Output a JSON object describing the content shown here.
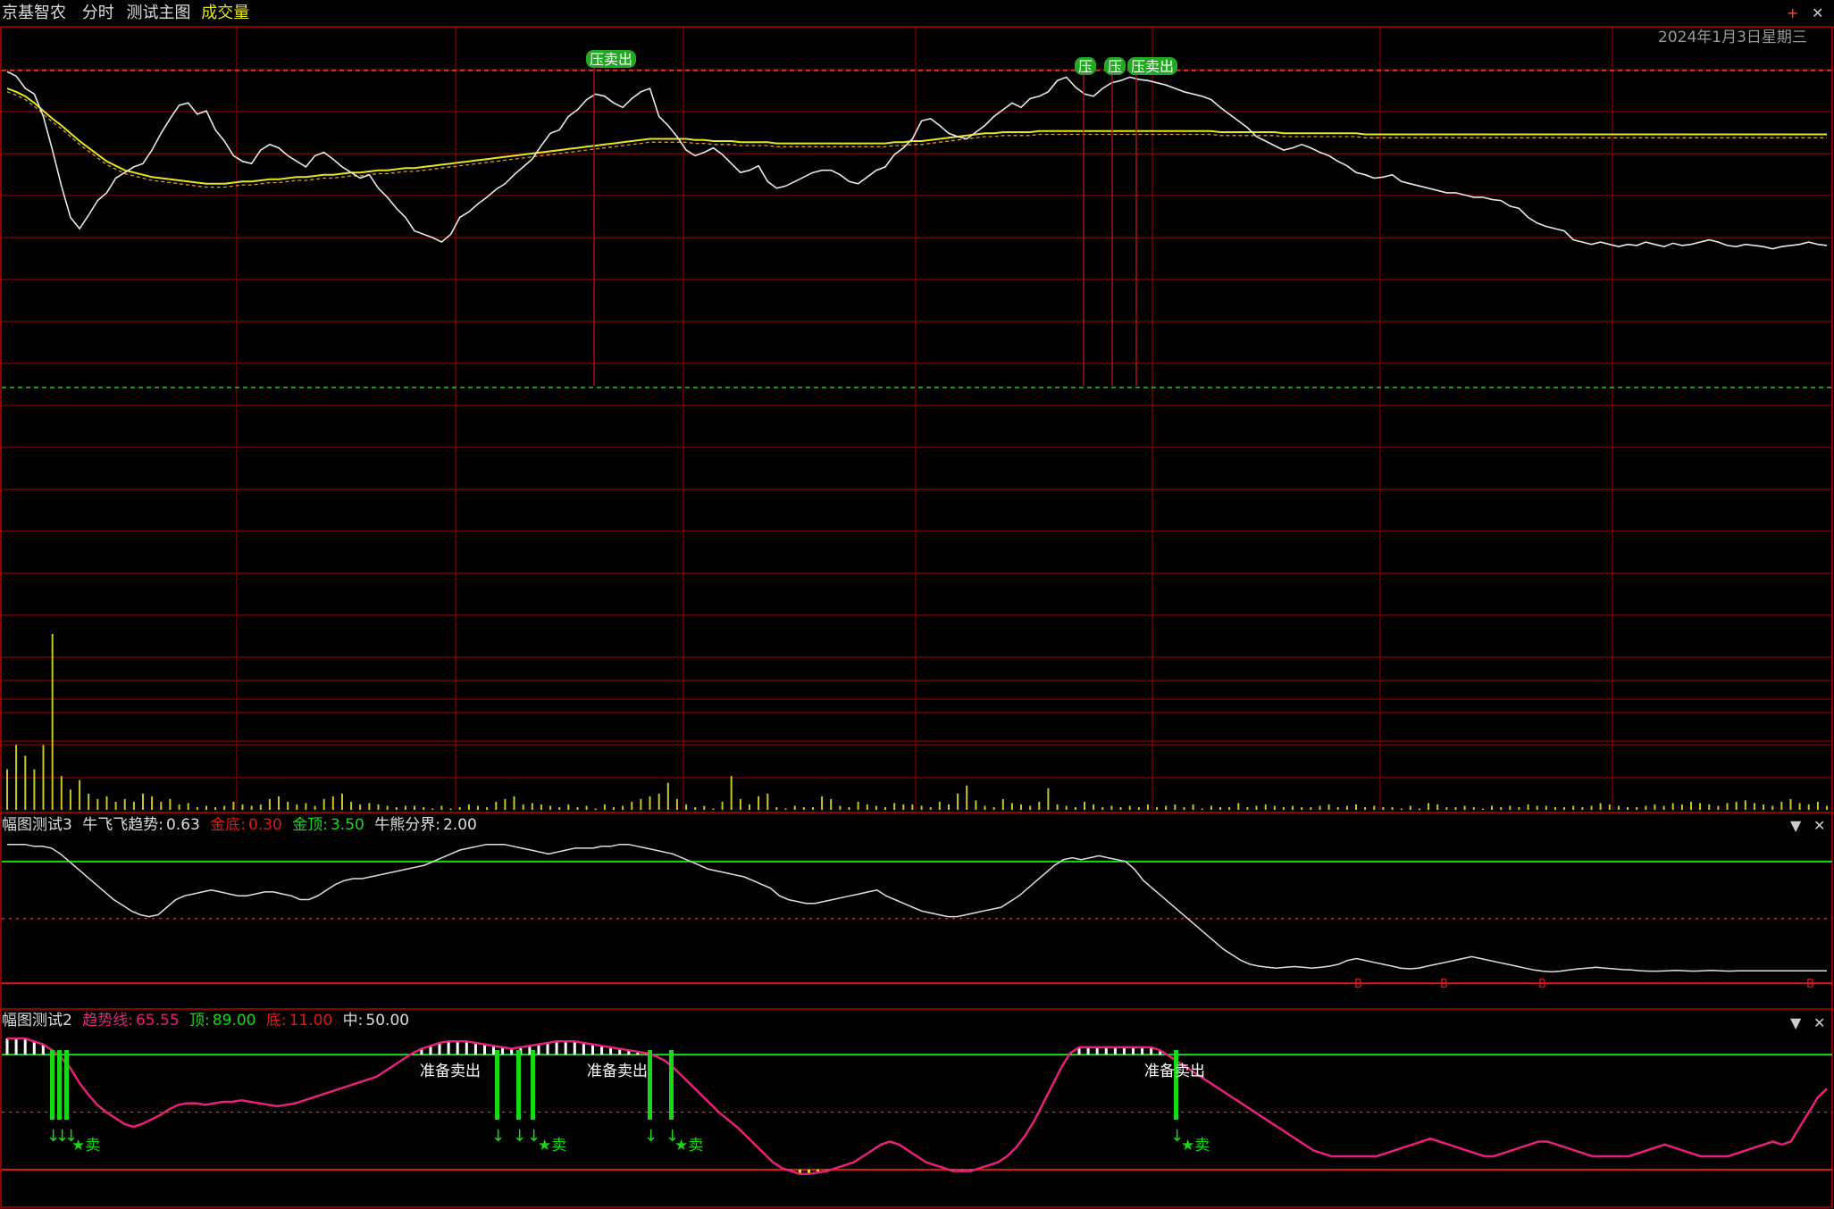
{
  "header": {
    "stock_name": "京基智农",
    "mode": "分时",
    "indicator": "测试主图",
    "volume_label": "成交量",
    "date": "2024年1月3日星期三"
  },
  "panel3": {
    "name": "幅图测试3",
    "trend_label": "牛飞飞趋势:",
    "trend_value": "0.63",
    "gold_bottom_label": "金底:",
    "gold_bottom_value": "0.30",
    "gold_top_label": "金顶:",
    "gold_top_value": "3.50",
    "divide_label": "牛熊分界:",
    "divide_value": "2.00"
  },
  "panel2": {
    "name": "幅图测试2",
    "trend_label": "趋势线:",
    "trend_value": "65.55",
    "top_label": "顶:",
    "top_value": "89.00",
    "bottom_label": "底:",
    "bottom_value": "11.00",
    "mid_label": "中:",
    "mid_value": "50.00"
  },
  "signals": {
    "pressure_sell": "压卖出",
    "pressure": "压",
    "ready_sell": "准备卖出",
    "sell": "卖",
    "star_sell": "★卖",
    "down_arrow": "↓",
    "b_mark": "B"
  },
  "icons": {
    "panel_menu": "▼",
    "panel_close": "✕",
    "window_zoom": "+",
    "window_close": "✕"
  },
  "colors": {
    "background": "#000000",
    "grid": "#8b0000",
    "price_line": "#e8e8e8",
    "avg_line": "#e6e620",
    "volume": "#c8c81e",
    "green": "#18d818",
    "red": "#e01818",
    "magenta": "#e8207a",
    "label_green_bg": "#22a822"
  },
  "chart_data": [
    {
      "type": "line",
      "title": "测试主图",
      "series": [
        {
          "values": [
            280,
            276,
            265,
            260,
            240,
            210,
            178,
            150,
            140,
            152,
            165,
            172,
            185,
            190,
            195,
            198,
            210,
            225,
            238,
            250,
            252,
            242,
            245,
            228,
            218,
            205,
            200,
            198,
            210,
            215,
            212,
            205,
            200,
            195,
            205,
            208,
            202,
            195,
            190,
            185,
            188,
            176,
            168,
            158,
            150,
            138,
            135,
            132,
            128,
            135,
            150,
            155,
            162,
            168,
            175,
            180,
            188,
            195,
            202,
            214,
            225,
            228,
            240,
            246,
            255,
            260,
            258,
            252,
            248,
            256,
            262,
            265,
            240,
            232,
            222,
            210,
            205,
            208,
            212,
            206,
            198,
            190,
            192,
            196,
            182,
            176,
            178,
            182,
            186,
            190,
            192,
            192,
            188,
            182,
            180,
            186,
            192,
            195,
            206,
            212,
            220,
            236,
            238,
            232,
            225,
            222,
            220,
            226,
            232,
            240,
            246,
            252,
            248,
            256,
            258,
            262,
            272,
            275,
            266,
            260,
            258,
            265,
            270,
            272,
            275,
            273,
            272,
            270,
            268,
            265,
            262,
            260,
            258,
            255,
            248,
            242,
            236,
            230,
            222,
            218,
            214,
            210,
            212,
            215,
            212,
            208,
            205,
            200,
            196,
            190,
            188,
            185,
            186,
            188,
            182,
            180,
            178,
            176,
            174,
            172,
            172,
            170,
            168,
            168,
            166,
            165,
            160,
            158,
            150,
            145,
            142,
            140,
            138,
            130,
            128,
            126,
            128,
            126,
            124,
            126,
            125,
            128,
            126,
            124,
            127,
            125,
            126,
            128,
            130,
            128,
            125,
            124,
            126,
            125,
            124,
            122,
            124,
            125,
            126,
            128,
            126,
            125
          ]
        },
        {
          "values": [
            265,
            262,
            258,
            252,
            245,
            238,
            232,
            225,
            218,
            212,
            206,
            200,
            196,
            192,
            190,
            188,
            186,
            185,
            184,
            183,
            182,
            181,
            180,
            180,
            180,
            181,
            182,
            182,
            183,
            184,
            184,
            185,
            186,
            186,
            187,
            188,
            188,
            189,
            190,
            190,
            191,
            192,
            192,
            193,
            194,
            194,
            195,
            196,
            197,
            198,
            199,
            200,
            201,
            202,
            203,
            204,
            205,
            206,
            207,
            208,
            209,
            210,
            211,
            212,
            213,
            214,
            215,
            216,
            217,
            218,
            219,
            220,
            220,
            220,
            220,
            220,
            219,
            219,
            218,
            218,
            218,
            217,
            217,
            217,
            217,
            216,
            216,
            216,
            216,
            216,
            216,
            216,
            216,
            216,
            216,
            216,
            216,
            216,
            217,
            217,
            218,
            218,
            219,
            220,
            221,
            222,
            223,
            224,
            225,
            225,
            226,
            226,
            226,
            226,
            227,
            227,
            227,
            227,
            227,
            227,
            227,
            227,
            227,
            227,
            227,
            227,
            227,
            227,
            227,
            227,
            227,
            227,
            227,
            227,
            226,
            226,
            226,
            226,
            226,
            226,
            226,
            225,
            225,
            225,
            225,
            225,
            225,
            225,
            225,
            225,
            224,
            224,
            224,
            224,
            224,
            224,
            224,
            224,
            224,
            224,
            224,
            224,
            224,
            224,
            224,
            224,
            224,
            224,
            224,
            224,
            224,
            224,
            224,
            224,
            224,
            224,
            224,
            224,
            224,
            224,
            224,
            224,
            224,
            224,
            224,
            224,
            224,
            224,
            224,
            224,
            224,
            224,
            224,
            224,
            224,
            224,
            224,
            224,
            224,
            224,
            224,
            224
          ]
        }
      ]
    },
    {
      "type": "bar",
      "title": "成交量",
      "values": [
        30,
        48,
        40,
        30,
        48,
        130,
        25,
        15,
        22,
        12,
        8,
        10,
        6,
        8,
        6,
        12,
        10,
        6,
        8,
        4,
        5,
        2,
        3,
        2,
        3,
        6,
        4,
        3,
        4,
        8,
        10,
        6,
        4,
        5,
        3,
        8,
        10,
        12,
        6,
        4,
        5,
        4,
        3,
        2,
        3,
        3,
        2,
        1,
        3,
        1,
        2,
        4,
        3,
        2,
        6,
        8,
        10,
        4,
        5,
        4,
        3,
        2,
        4,
        2,
        3,
        1,
        4,
        2,
        3,
        6,
        8,
        10,
        12,
        20,
        8,
        4,
        2,
        3,
        1,
        6,
        25,
        8,
        4,
        10,
        12,
        2,
        1,
        3,
        2,
        2,
        10,
        8,
        3,
        2,
        6,
        4,
        3,
        2,
        5,
        4,
        4,
        3,
        2,
        6,
        4,
        12,
        18,
        7,
        3,
        2,
        8,
        5,
        4,
        3,
        6,
        16,
        4,
        3,
        2,
        6,
        4,
        2,
        3,
        2,
        3,
        2,
        4,
        2,
        3,
        4,
        2,
        4,
        1,
        3,
        2,
        2,
        5,
        2,
        3,
        4,
        3,
        2,
        3,
        2,
        2,
        3,
        4,
        2,
        3,
        4,
        2,
        3,
        2,
        2,
        1,
        3,
        1,
        5,
        4,
        2,
        2,
        3,
        2,
        1,
        3,
        2,
        3,
        2,
        4,
        3,
        3,
        2,
        2,
        3,
        2,
        3,
        5,
        4,
        3,
        2,
        2,
        3,
        4,
        3,
        5,
        4,
        6,
        5,
        4,
        3,
        5,
        6,
        7,
        5,
        4,
        3,
        6,
        8,
        5,
        4,
        6,
        3
      ]
    },
    {
      "type": "line",
      "title": "幅图测试3",
      "series": [
        {
          "name": "牛飞飞趋势",
          "values": [
            3.95,
            3.95,
            3.95,
            3.9,
            3.9,
            3.85,
            3.7,
            3.5,
            3.3,
            3.1,
            2.9,
            2.7,
            2.5,
            2.35,
            2.2,
            2.1,
            2.05,
            2.1,
            2.3,
            2.5,
            2.6,
            2.65,
            2.7,
            2.75,
            2.7,
            2.65,
            2.6,
            2.6,
            2.65,
            2.7,
            2.7,
            2.65,
            2.6,
            2.5,
            2.5,
            2.6,
            2.75,
            2.9,
            3.0,
            3.05,
            3.05,
            3.1,
            3.15,
            3.2,
            3.25,
            3.3,
            3.35,
            3.4,
            3.5,
            3.6,
            3.7,
            3.8,
            3.85,
            3.9,
            3.95,
            3.95,
            3.95,
            3.9,
            3.85,
            3.8,
            3.75,
            3.7,
            3.75,
            3.8,
            3.85,
            3.85,
            3.85,
            3.9,
            3.9,
            3.95,
            3.95,
            3.9,
            3.85,
            3.8,
            3.75,
            3.7,
            3.6,
            3.5,
            3.4,
            3.3,
            3.25,
            3.2,
            3.15,
            3.1,
            3.0,
            2.9,
            2.8,
            2.6,
            2.5,
            2.45,
            2.4,
            2.4,
            2.45,
            2.5,
            2.55,
            2.6,
            2.65,
            2.7,
            2.75,
            2.6,
            2.5,
            2.4,
            2.3,
            2.2,
            2.15,
            2.1,
            2.05,
            2.05,
            2.1,
            2.15,
            2.2,
            2.25,
            2.3,
            2.45,
            2.6,
            2.8,
            3.0,
            3.2,
            3.4,
            3.55,
            3.6,
            3.55,
            3.6,
            3.65,
            3.6,
            3.55,
            3.5,
            3.3,
            3.0,
            2.8,
            2.6,
            2.4,
            2.2,
            2.0,
            1.8,
            1.6,
            1.4,
            1.2,
            1.05,
            0.9,
            0.8,
            0.75,
            0.72,
            0.7,
            0.72,
            0.74,
            0.72,
            0.7,
            0.72,
            0.75,
            0.8,
            0.9,
            0.95,
            0.9,
            0.85,
            0.8,
            0.75,
            0.7,
            0.68,
            0.7,
            0.75,
            0.8,
            0.85,
            0.9,
            0.95,
            1.0,
            0.95,
            0.9,
            0.85,
            0.8,
            0.75,
            0.7,
            0.65,
            0.62,
            0.6,
            0.62,
            0.65,
            0.68,
            0.7,
            0.72,
            0.7,
            0.68,
            0.66,
            0.65,
            0.63,
            0.62,
            0.62,
            0.63,
            0.64,
            0.63,
            0.62,
            0.63,
            0.64,
            0.63,
            0.62,
            0.63,
            0.63,
            0.63,
            0.63,
            0.63,
            0.63,
            0.63,
            0.63,
            0.63,
            0.63,
            0.63
          ]
        }
      ]
    },
    {
      "type": "line",
      "title": "幅图测试2",
      "series": [
        {
          "name": "趋势线",
          "values": [
            100,
            100,
            100,
            98,
            96,
            92,
            87,
            80,
            70,
            62,
            55,
            50,
            46,
            42,
            40,
            42,
            45,
            48,
            52,
            55,
            56,
            56,
            55,
            56,
            57,
            57,
            58,
            57,
            56,
            55,
            54,
            55,
            56,
            58,
            60,
            62,
            64,
            66,
            68,
            70,
            72,
            74,
            78,
            82,
            86,
            90,
            93,
            95,
            97,
            98,
            98,
            98,
            97,
            96,
            95,
            94,
            93,
            94,
            95,
            96,
            97,
            98,
            98,
            98,
            97,
            96,
            95,
            94,
            93,
            92,
            91,
            90,
            88,
            85,
            80,
            74,
            68,
            62,
            56,
            50,
            45,
            40,
            34,
            28,
            22,
            16,
            12,
            10,
            8,
            8,
            9,
            10,
            12,
            14,
            16,
            20,
            24,
            28,
            30,
            28,
            24,
            20,
            16,
            14,
            12,
            10,
            10,
            10,
            12,
            14,
            16,
            20,
            26,
            34,
            44,
            56,
            68,
            80,
            90,
            94,
            94,
            94,
            94,
            94,
            94,
            94,
            94,
            94,
            92,
            88,
            84,
            80,
            76,
            72,
            68,
            64,
            60,
            56,
            52,
            48,
            44,
            40,
            36,
            32,
            28,
            24,
            22,
            20,
            20,
            20,
            20,
            20,
            20,
            22,
            24,
            26,
            28,
            30,
            32,
            30,
            28,
            26,
            24,
            22,
            20,
            20,
            22,
            24,
            26,
            28,
            30,
            30,
            28,
            26,
            24,
            22,
            20,
            20,
            20,
            20,
            20,
            22,
            24,
            26,
            28,
            26,
            24,
            22,
            20,
            20,
            20,
            20,
            22,
            24,
            26,
            28,
            30,
            28,
            30,
            40,
            50,
            60,
            66
          ]
        }
      ]
    }
  ]
}
